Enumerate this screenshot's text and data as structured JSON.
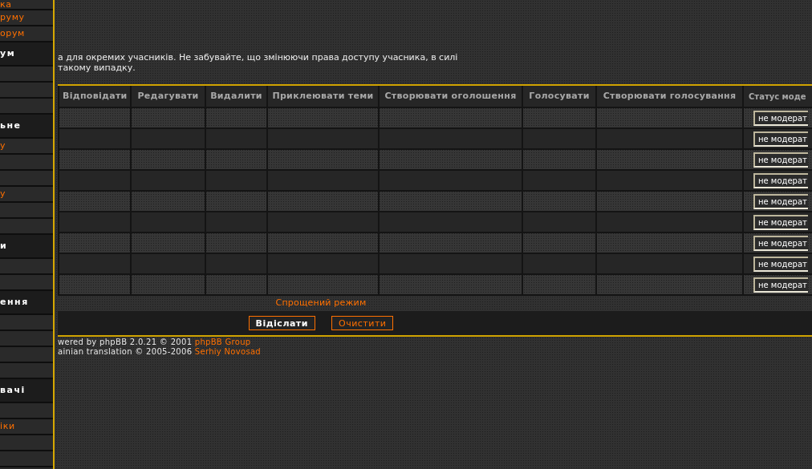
{
  "sidebar": {
    "sections": [
      {
        "items": [
          {
            "kind": "link",
            "label": "ка"
          },
          {
            "kind": "link",
            "label": "руму"
          },
          {
            "kind": "link",
            "label": "орум"
          }
        ]
      },
      {
        "title": "ум",
        "items": [
          {
            "kind": "blank"
          },
          {
            "kind": "blank"
          },
          {
            "kind": "blank"
          }
        ]
      },
      {
        "title": "ьне",
        "items": [
          {
            "kind": "link",
            "label": "у"
          },
          {
            "kind": "blank"
          },
          {
            "kind": "blank"
          },
          {
            "kind": "link",
            "label": "у"
          },
          {
            "kind": "blank"
          },
          {
            "kind": "blank"
          }
        ]
      },
      {
        "title": "и",
        "items": [
          {
            "kind": "blank"
          },
          {
            "kind": "blank"
          }
        ]
      },
      {
        "title": "ення",
        "items": [
          {
            "kind": "blank"
          },
          {
            "kind": "blank"
          },
          {
            "kind": "blank"
          },
          {
            "kind": "blank"
          }
        ]
      },
      {
        "title": "вачі",
        "items": [
          {
            "kind": "blank"
          },
          {
            "kind": "link",
            "label": "іки"
          },
          {
            "kind": "blank"
          },
          {
            "kind": "blank"
          }
        ]
      }
    ]
  },
  "intro": [
    "а для окремих учасників. Не забувайте, що змінюючи права доступу учасника, в силі",
    "такому випадку."
  ],
  "permissions_table": {
    "columns": [
      "Відповідати",
      "Редагувати",
      "Видалити",
      "Приклеювати теми",
      "Створювати оголошення",
      "Голосувати",
      "Створювати голосування",
      "Статус моде"
    ],
    "rows": [
      {
        "moderator_status": "не модерат"
      },
      {
        "moderator_status": "не модерат"
      },
      {
        "moderator_status": "не модерат"
      },
      {
        "moderator_status": "не модерат"
      },
      {
        "moderator_status": "не модерат"
      },
      {
        "moderator_status": "не модерат"
      },
      {
        "moderator_status": "не модерат"
      },
      {
        "moderator_status": "не модерат"
      },
      {
        "moderator_status": "не модерат"
      }
    ]
  },
  "simple_mode_link": "Спрощений режим",
  "buttons": [
    {
      "kind": "submit",
      "label": "Відіслати"
    },
    {
      "kind": "reset",
      "label": "Очистити"
    }
  ],
  "footer": [
    {
      "text": "wered by phpBB 2.0.21 © 2001",
      "link": "phpBB Group"
    },
    {
      "text": "ainian translation © 2005-2006",
      "link": "Serhiy Novosad"
    }
  ]
}
